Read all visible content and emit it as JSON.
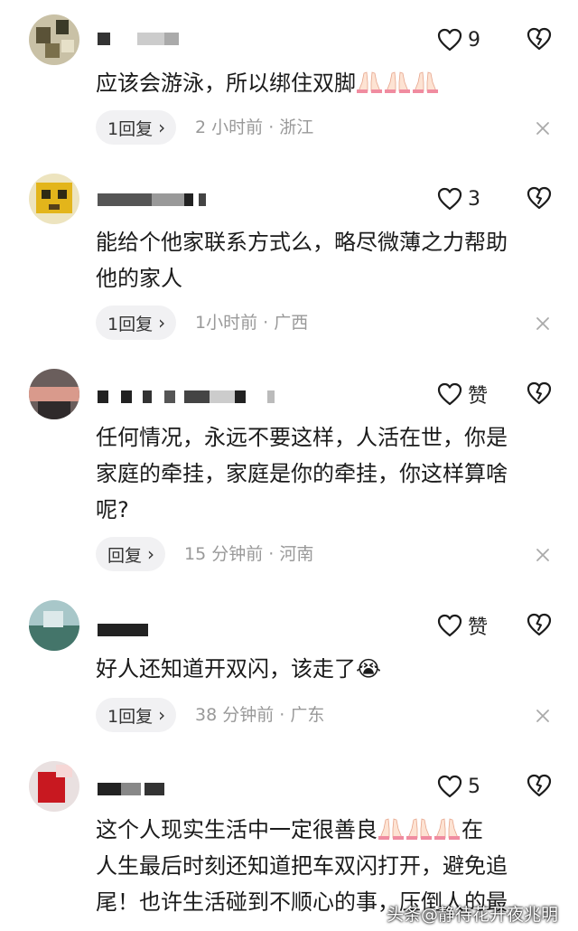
{
  "comments": [
    {
      "text": "应该会游泳，所以绑住双脚",
      "emoji": "🙏🏻🙏🏻🙏🏻",
      "likes": "9",
      "reply_label": "1回复",
      "time": "2 小时前",
      "location": "浙江"
    },
    {
      "text": "能给个他家联系方式么，略尽微薄之力帮助\n他的家人",
      "likes": "3",
      "reply_label": "1回复",
      "time": "1小时前",
      "location": "广西"
    },
    {
      "text": "任何情况，永远不要这样，人活在世，你是\n家庭的牵挂，家庭是你的牵挂，你这样算啥\n呢?",
      "likes": "赞",
      "reply_label": "回复",
      "time": "15 分钟前",
      "location": "河南"
    },
    {
      "text": "好人还知道开双闪，该走了",
      "emoji": "😭",
      "likes": "赞",
      "reply_label": "1回复",
      "time": "38 分钟前",
      "location": "广东"
    },
    {
      "text_a": "这个人现实生活中一定很善良",
      "emoji": "🙏🏻🙏🏻🙏🏻",
      "text_b": "在\n人生最后时刻还知道把车双闪打开，避免追\n尾！也许生活碰到不顺心的事，压倒人的最",
      "likes": "5"
    }
  ],
  "separator": "·",
  "watermark": "头条@静待花开夜兆明",
  "icons": {
    "like": "heart-outline-icon",
    "dislike": "broken-heart-icon",
    "close": "close-x-icon",
    "chevron": "chevron-right-icon"
  },
  "colors": {
    "meta_gray": "#999999",
    "pill_bg": "#f1f1f3"
  }
}
